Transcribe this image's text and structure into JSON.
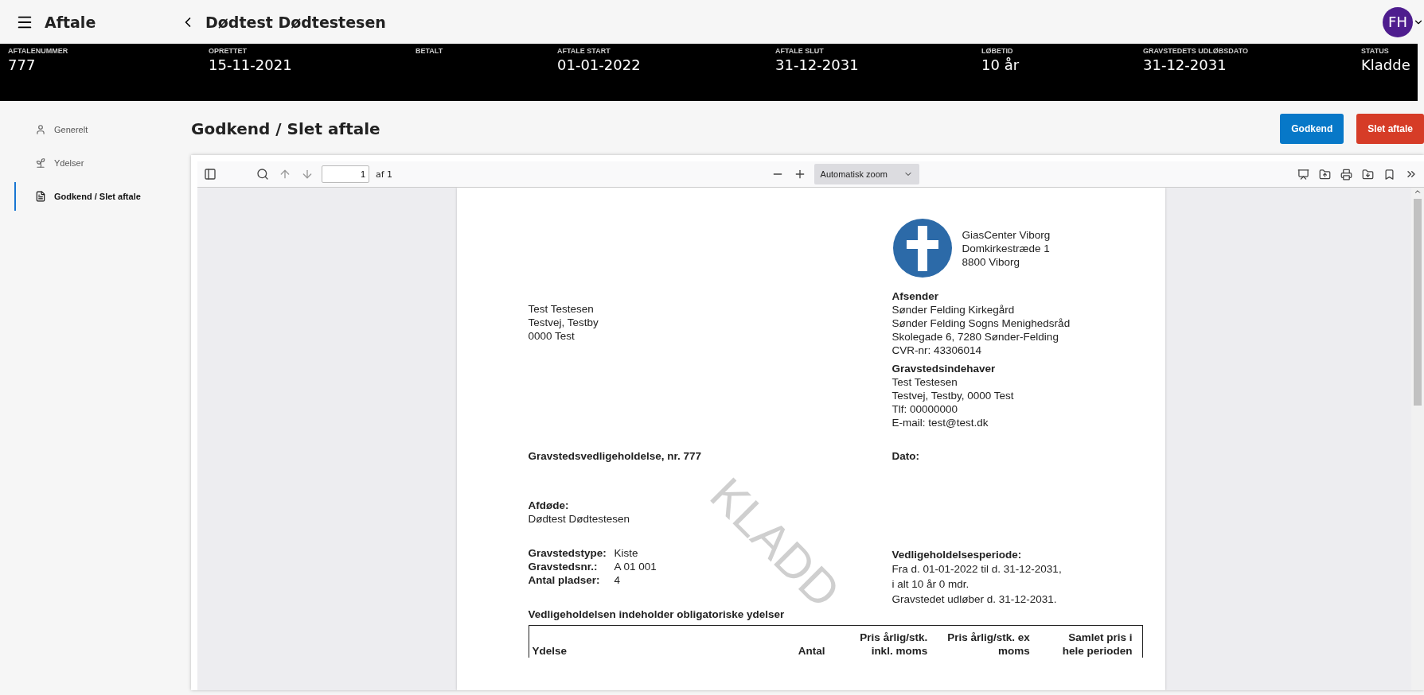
{
  "app_bar": {
    "title": "Aftale",
    "back_title": "Dødtest Dødtestesen",
    "avatar": "FH"
  },
  "summary": [
    {
      "label": "AFTALENUMMER",
      "value": "777"
    },
    {
      "label": "OPRETTET",
      "value": "15-11-2021"
    },
    {
      "label": "BETALT"
    },
    {
      "label": "AFTALE START",
      "value": "01-01-2022"
    },
    {
      "label": "AFTALE SLUT",
      "value": "31-12-2031"
    },
    {
      "label": "LØBETID",
      "value": "10 år"
    },
    {
      "label": "GRAVSTEDETS UDLØBSDATO",
      "value": "31-12-2031"
    },
    {
      "label": "STATUS",
      "value": "Kladde"
    }
  ],
  "sidebar": {
    "items": [
      {
        "label": "Generelt",
        "selected": false
      },
      {
        "label": "Ydelser",
        "selected": false
      },
      {
        "label": "Godkend / Slet aftale",
        "selected": true
      }
    ]
  },
  "page_title": "Godkend / Slet aftale",
  "buttons": [
    {
      "label": "Godkend",
      "kind": "primary"
    },
    {
      "label": "Slet aftale",
      "kind": "danger"
    }
  ],
  "viewer": {
    "page_number": "1",
    "page_count": "af 1",
    "zoom": "Automatisk zoom",
    "document": {
      "issuer": [
        "GiasCenter Viborg",
        "Domkirkestræde 1",
        "8800 Viborg"
      ],
      "recipient": [
        "Test Testesen",
        "Testvej, Testby",
        "0000 Test"
      ],
      "sections": [
        {
          "heading": "Afsender",
          "lines": [
            "Sønder Felding Kirkegård",
            "Sønder Felding Sogns Menighedsråd",
            "Skolegade 6, 7280  Sønder-Felding",
            "CVR-nr: 43306014"
          ]
        },
        {
          "heading": "Gravstedsindehaver",
          "lines": [
            "Test Testesen",
            "Testvej, Testby, 0000 Test",
            "Tlf: 00000000",
            "E-mail: test@test.dk"
          ]
        }
      ],
      "title": "Gravstedsvedligeholdelse, nr. 777",
      "date_label": "Dato:",
      "deceased": {
        "label": "Afdøde:",
        "name": "Dødtest Dødtestesen"
      },
      "fields": [
        {
          "label": "Gravstedstype:",
          "value": "Kiste"
        },
        {
          "label": "Gravstedsnr.:",
          "value": "A 01 001"
        },
        {
          "label": "Antal pladser:",
          "value": "4"
        }
      ],
      "period": {
        "heading": "Vedligeholdelsesperiode:",
        "lines": [
          "Fra d. 01-01-2022 til d. 31-12-2031,",
          "i alt 10 år 0 mdr.",
          "Gravstedet udløber d. 31-12-2031."
        ]
      },
      "table_caption": "Vedligeholdelsen indeholder obligatoriske ydelser",
      "table_columns": [
        "Ydelse",
        "Antal",
        "Pris årlig/stk. inkl. moms",
        "Pris årlig/stk. ex moms",
        "Samlet pris i hele perioden"
      ],
      "stamp": "KLADD"
    }
  }
}
